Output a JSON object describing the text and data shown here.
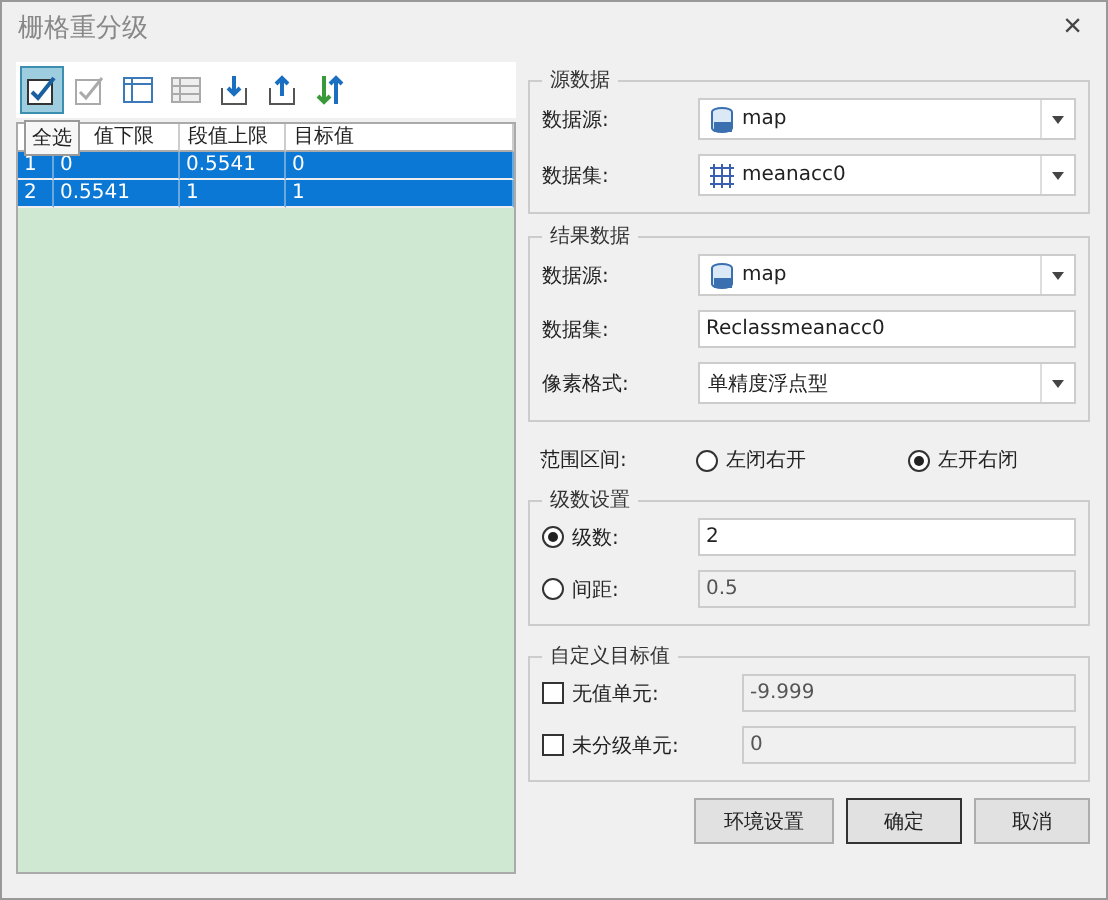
{
  "window": {
    "title": "栅格重分级",
    "close": "×"
  },
  "toolbar": {
    "tooltip": "全选",
    "tools": [
      {
        "kind": "check-all",
        "selected": true
      },
      {
        "kind": "check-none",
        "selected": false
      },
      {
        "kind": "table",
        "selected": false
      },
      {
        "kind": "table-disabled",
        "selected": false
      },
      {
        "kind": "import",
        "selected": false
      },
      {
        "kind": "export",
        "selected": false
      },
      {
        "kind": "swap",
        "selected": false
      }
    ]
  },
  "table": {
    "columns": [
      "",
      "值下限",
      "段值上限",
      "目标值"
    ],
    "rows": [
      {
        "cells": [
          "1",
          "0",
          "0.5541",
          "0"
        ],
        "selected": true
      },
      {
        "cells": [
          "2",
          "0.5541",
          "1",
          "1"
        ],
        "selected": true
      }
    ]
  },
  "source": {
    "legend": "源数据",
    "fields": [
      {
        "label": "数据源:",
        "value": "map",
        "kind": "dropdown"
      },
      {
        "label": "数据集:",
        "value": "meanacc0",
        "kind": "dropdown"
      }
    ]
  },
  "result": {
    "legend": "结果数据",
    "fields": [
      {
        "label": "数据源:",
        "value": "map",
        "kind": "dropdown"
      },
      {
        "label": "数据集:",
        "value": "Reclassmeanacc0",
        "kind": "text"
      },
      {
        "label": "像素格式:",
        "value": "单精度浮点型",
        "kind": "dropdown"
      }
    ]
  },
  "range": {
    "label": "范围区间:",
    "options": [
      {
        "label": "左闭右开",
        "selected": false
      },
      {
        "label": "左开右闭",
        "selected": true
      }
    ]
  },
  "levels": {
    "legend": "级数设置",
    "rows": [
      {
        "label": "级数:",
        "value": "2",
        "selected": true
      },
      {
        "label": "间距:",
        "value": "0.5",
        "selected": false
      }
    ]
  },
  "custom": {
    "legend": "自定义目标值",
    "rows": [
      {
        "label": "无值单元:",
        "value": "-9.999",
        "checked": false
      },
      {
        "label": "未分级单元:",
        "value": "0",
        "checked": false
      }
    ]
  },
  "buttons": [
    {
      "label": "环境设置",
      "default": false
    },
    {
      "label": "确定",
      "default": true
    },
    {
      "label": "取消",
      "default": false
    }
  ]
}
